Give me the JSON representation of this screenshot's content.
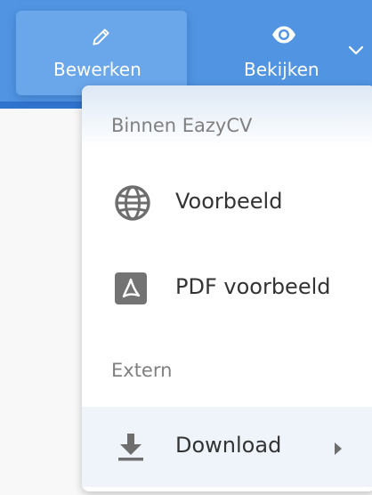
{
  "toolbar": {
    "edit": {
      "label": "Bewerken",
      "icon": "pencil-icon"
    },
    "view": {
      "label": "Bekijken",
      "icon": "eye-icon"
    },
    "dropdown_icon": "chevron-down-icon",
    "colors": {
      "bar": "#5094e2",
      "stripe": "#2f74cf",
      "active_tab": "#6aa6ea"
    }
  },
  "menu": {
    "sections": [
      {
        "label": "Binnen EazyCV",
        "items": [
          {
            "label": "Voorbeeld",
            "icon": "globe-icon"
          },
          {
            "label": "PDF voorbeeld",
            "icon": "pdf-icon"
          }
        ]
      },
      {
        "label": "Extern",
        "items": [
          {
            "label": "Download",
            "icon": "download-icon",
            "submenu_icon": "caret-right-icon"
          }
        ]
      }
    ]
  }
}
